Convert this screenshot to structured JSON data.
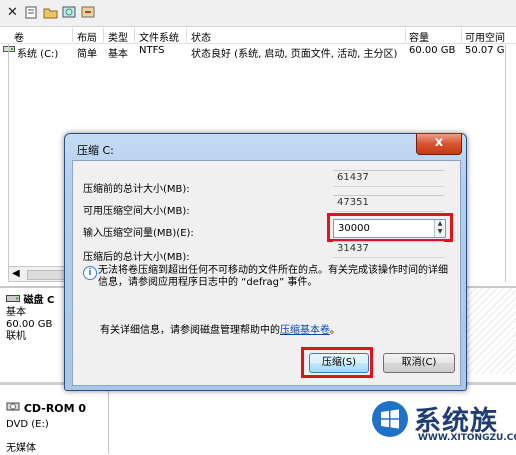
{
  "toolbar": {
    "icons": [
      "delete-icon",
      "properties-icon",
      "open-icon",
      "search-icon",
      "refresh-icon"
    ]
  },
  "volume_list": {
    "columns": [
      "卷",
      "布局",
      "类型",
      "文件系统",
      "状态",
      "容量",
      "可用空间"
    ],
    "rows": [
      {
        "volume": "系统 (C:)",
        "layout": "简单",
        "type": "基本",
        "fs": "NTFS",
        "status": "状态良好 (系统, 启动, 页面文件, 活动, 主分区)",
        "capacity": "60.00 GB",
        "free": "50.07 G"
      }
    ]
  },
  "disks": [
    {
      "name": "磁盘 0",
      "name_prefix": "磁盘 C",
      "type": "基本",
      "size": "60.00 GB",
      "status": "联机"
    },
    {
      "name": "CD-ROM 0",
      "type": "DVD (E:)",
      "status": "无媒体"
    }
  ],
  "dialog": {
    "title": "压缩 C:",
    "close_label": "x",
    "total_before_label": "压缩前的总计大小(MB):",
    "total_before_value": "61437",
    "available_label": "可用压缩空间大小(MB):",
    "available_value": "47351",
    "input_label": "输入压缩空间量(MB)(E):",
    "input_value": "30000",
    "total_after_label": "压缩后的总计大小(MB):",
    "total_after_value": "31437",
    "info_text": "无法将卷压缩到超出任何不可移动的文件所在的点。有关完成该操作时间的详细信息，请参阅应用程序日志中的 “defrag” 事件。",
    "help_prefix": "有关详细信息，请参阅磁盘管理帮助中的",
    "help_link": "压缩基本卷",
    "help_suffix": "。",
    "ok_label": "压缩(S)",
    "cancel_label": "取消(C)"
  },
  "watermark": {
    "title": "系统族",
    "url": "WWW.XITONGZU.COM"
  },
  "colors": {
    "highlight_red": "#e0141e",
    "dialog_frame": "#a9c6e8",
    "close_red": "#c23a1a"
  }
}
